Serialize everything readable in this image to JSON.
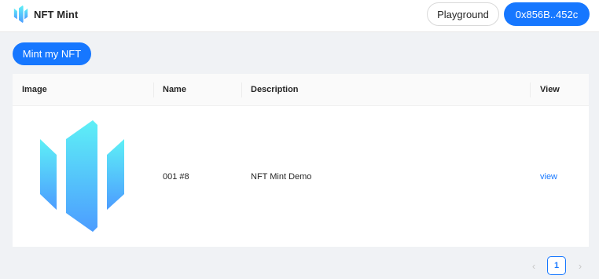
{
  "header": {
    "app_name": "NFT Mint",
    "playground_label": "Playground",
    "wallet_label": "0x856B..452c"
  },
  "actions": {
    "mint_label": "Mint my NFT"
  },
  "table": {
    "columns": [
      "Image",
      "Name",
      "Description",
      "View"
    ],
    "rows": [
      {
        "name": "001 #8",
        "description": "NFT Mint Demo",
        "view": "view"
      }
    ]
  },
  "pagination": {
    "prev_icon": "‹",
    "current_page": "1",
    "next_icon": "›"
  },
  "colors": {
    "primary": "#1677ff",
    "logo_gradient_top": "#5ef0f6",
    "logo_gradient_bottom": "#4c9cff"
  }
}
